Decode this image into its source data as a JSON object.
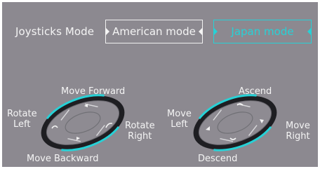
{
  "header": {
    "title": "Joysticks Mode"
  },
  "modes": {
    "american": {
      "label": "American mode",
      "selected": false
    },
    "japan": {
      "label": "Japan mode",
      "selected": true
    }
  },
  "left_stick": {
    "up": "Move Forward",
    "down": "Move Backward",
    "left_line1": "Rotate",
    "left_line2": "Left",
    "right_line1": "Rotate",
    "right_line2": "Right"
  },
  "right_stick": {
    "up": "Ascend",
    "down": "Descend",
    "left_line1": "Move",
    "left_line2": "Left",
    "right_line1": "Move",
    "right_line2": "Right"
  },
  "colors": {
    "panel": "#8c8990",
    "text": "#f4f4f4",
    "accent": "#27d1d6",
    "stick_dark": "#1e1e22",
    "pad_grey": "#8e8b92"
  }
}
